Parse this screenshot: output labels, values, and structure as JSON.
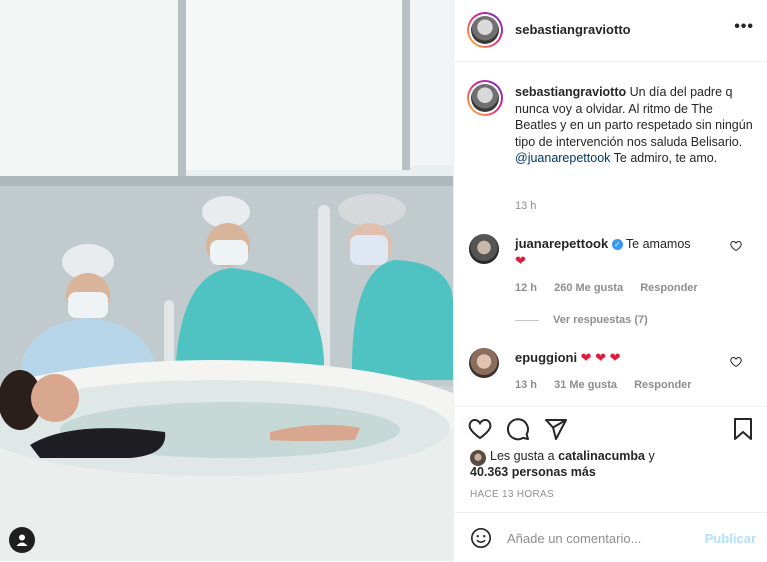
{
  "post": {
    "username": "sebastiangraviotto",
    "more_label": "•••",
    "caption_text": "Un día del padre q nunca voy a olvidar. Al ritmo de The Beatles y en un parto respetado sin ningún tipo de intervención nos saluda Belisario.",
    "caption_mention": "@juanarepettook",
    "caption_tail": "Te admiro, te amo.",
    "caption_time": "13 h"
  },
  "comments": [
    {
      "username": "juanarepettook",
      "verified_mark": "✓",
      "text": "Te amamos",
      "emoji": "❤",
      "time": "12 h",
      "likes": "260 Me gusta",
      "reply": "Responder",
      "view_replies": "Ver respuestas (7)"
    },
    {
      "username": "epuggioni",
      "emoji": "❤ ❤ ❤",
      "time": "13 h",
      "likes": "31 Me gusta",
      "reply": "Responder"
    }
  ],
  "likes": {
    "prefix": "Les gusta a",
    "user": "catalinacumba",
    "connector": "y",
    "count": "40.363 personas más"
  },
  "post_age": "HACE 13 HORAS",
  "add_comment": {
    "placeholder": "Añade un comentario...",
    "publish": "Publicar"
  },
  "icons": {
    "like": "heart-icon",
    "comment": "comment-icon",
    "share": "share-icon",
    "save": "bookmark-icon",
    "emoji": "emoji-icon",
    "tag": "user-tag-icon"
  },
  "colors": {
    "mention": "#00376b",
    "muted": "#8e8e8e",
    "heart": "#e21b3c",
    "publish": "#b2dffc"
  }
}
